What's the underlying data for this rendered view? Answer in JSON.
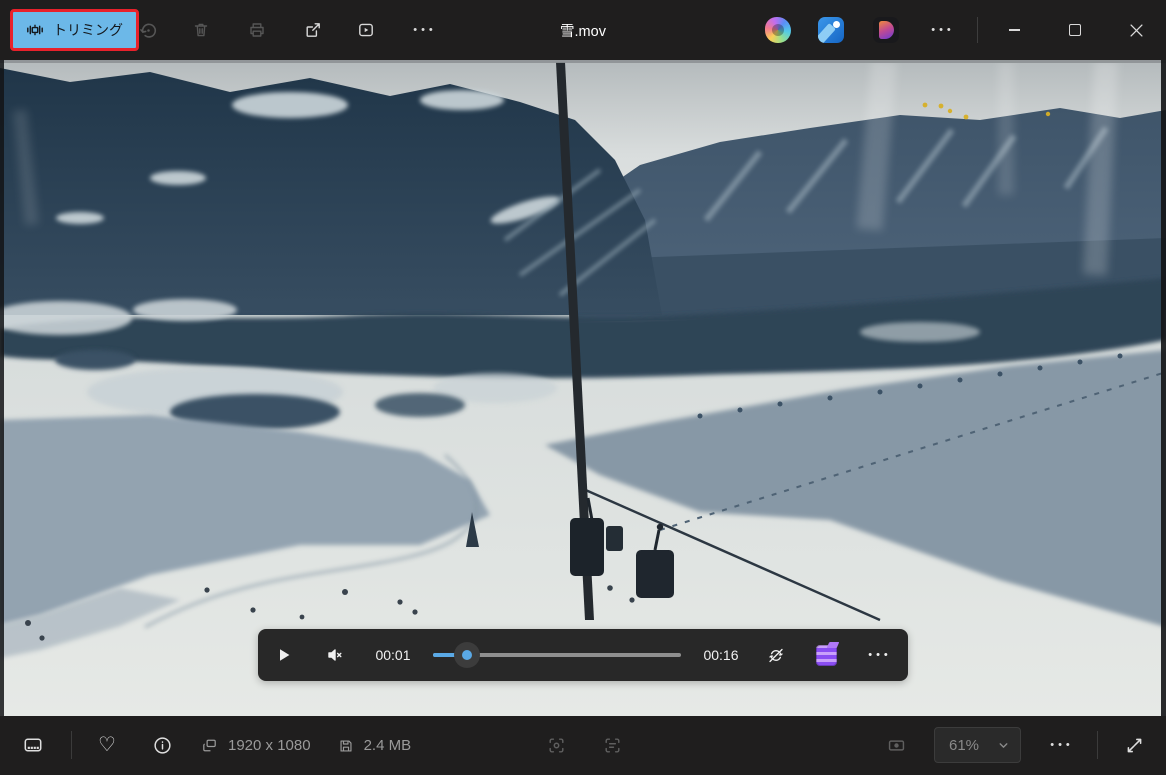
{
  "window": {
    "title": "雪.mov"
  },
  "top_toolbar": {
    "trim": {
      "label": "トリミング"
    },
    "actions_left": [
      "rotate",
      "delete",
      "print",
      "share",
      "slideshow",
      "more"
    ],
    "actions_right": [
      "copilot",
      "edit-image",
      "designer",
      "more"
    ]
  },
  "player": {
    "current_time": "00:01",
    "total_time": "00:16",
    "progress_pct": 14,
    "muted": true,
    "repeat_off": true
  },
  "bottom_toolbar": {
    "resolution": "1920 x 1080",
    "file_size": "2.4 MB",
    "zoom_level": "61%"
  },
  "glyphs": {
    "more": "•••",
    "heart": "♡"
  },
  "colors": {
    "accent": "#5AA9E6",
    "trim_bg": "#6CB8E8",
    "trim_border": "#E8212B",
    "toolbar_bg": "#1F1E1E",
    "player_bg": "#282828"
  }
}
